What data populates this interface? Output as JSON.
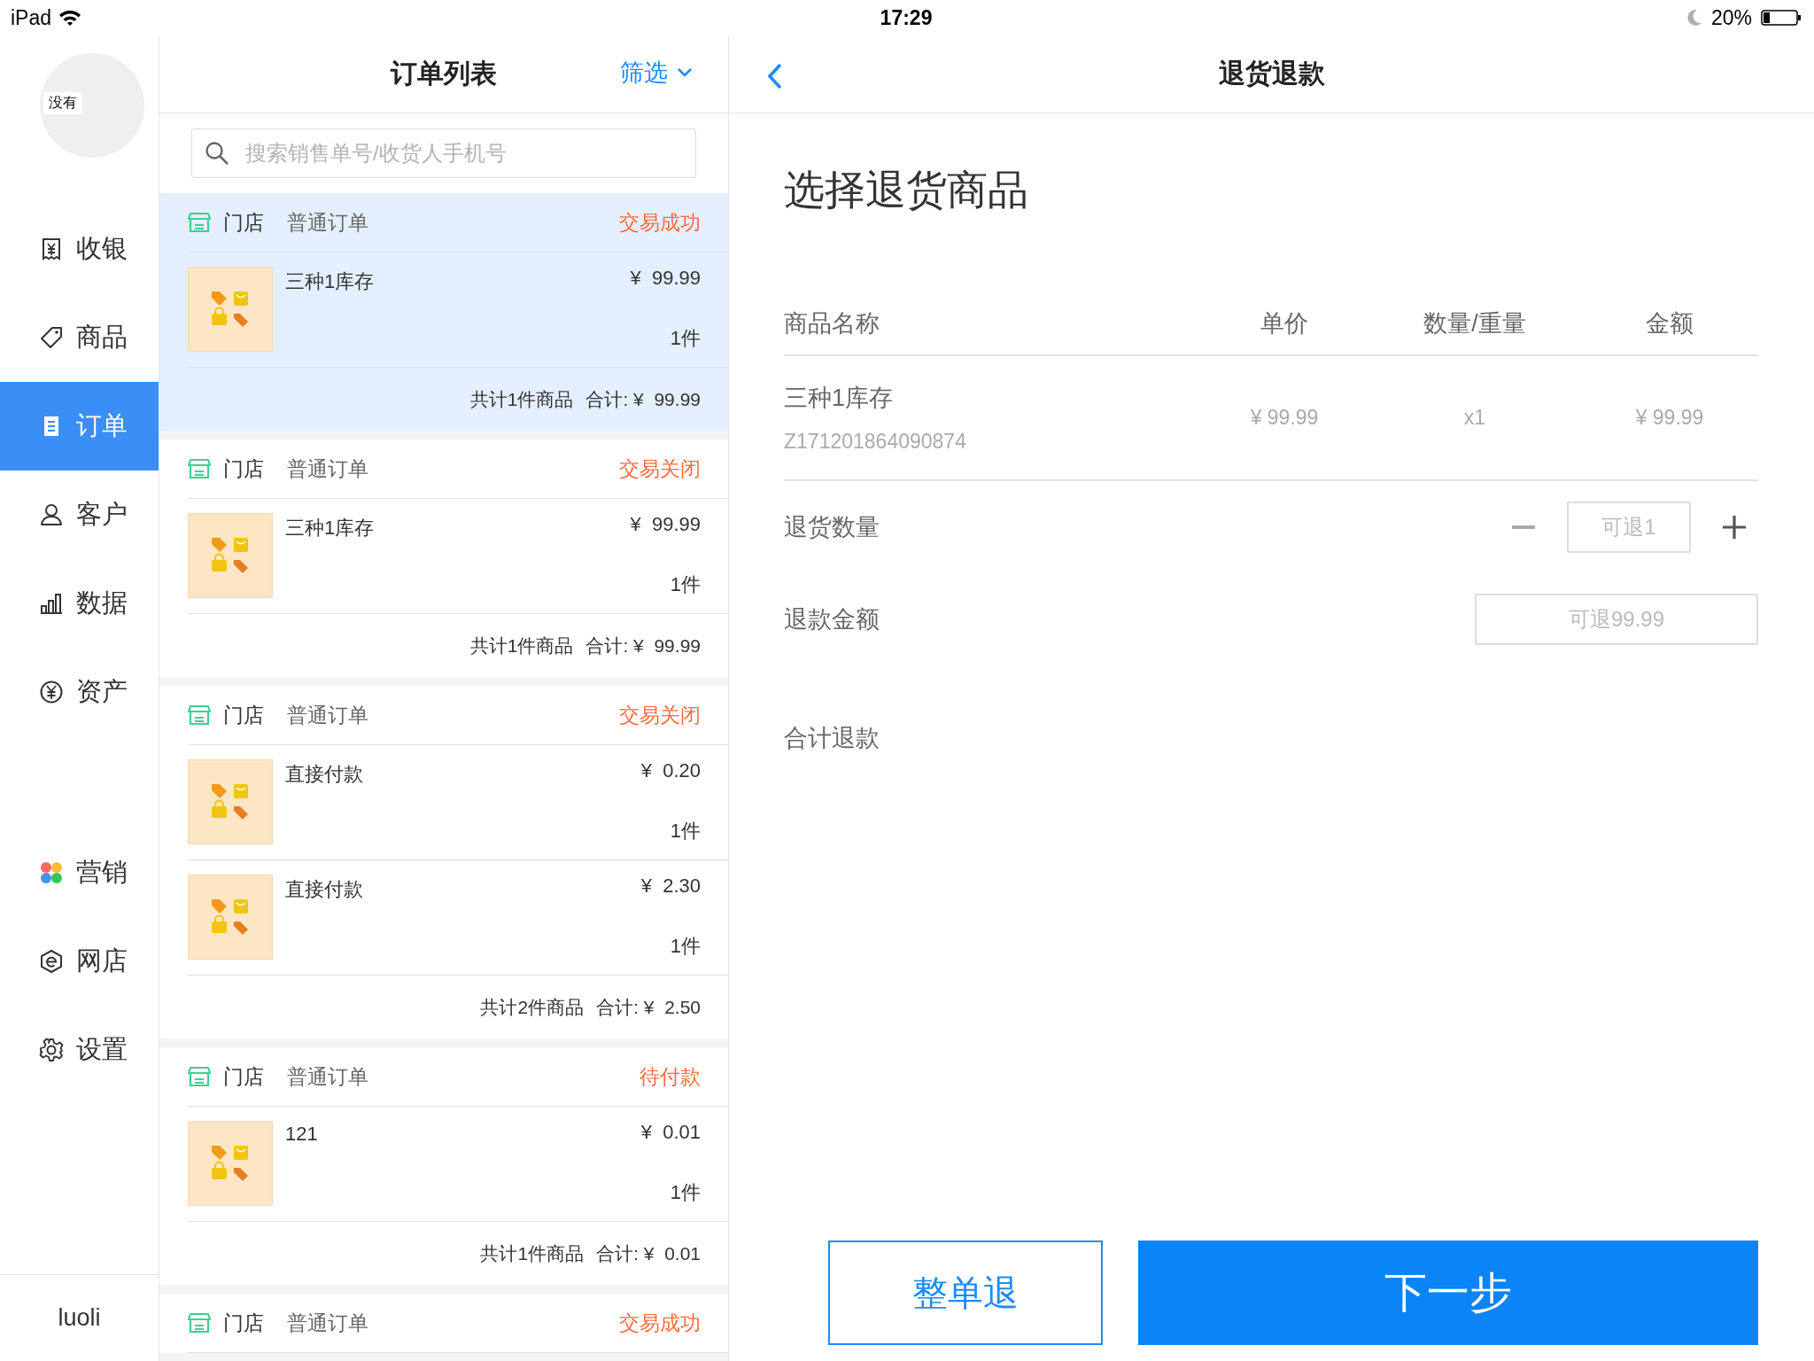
{
  "status_bar": {
    "device": "iPad",
    "time": "17:29",
    "battery": "20%"
  },
  "sidebar": {
    "avatar_text": "没有",
    "items": [
      {
        "label": "收银",
        "selected": false
      },
      {
        "label": "商品",
        "selected": false
      },
      {
        "label": "订单",
        "selected": true
      },
      {
        "label": "客户",
        "selected": false
      },
      {
        "label": "数据",
        "selected": false
      },
      {
        "label": "资产",
        "selected": false
      },
      {
        "label": "营销",
        "selected": false
      },
      {
        "label": "网店",
        "selected": false
      },
      {
        "label": "设置",
        "selected": false
      }
    ],
    "user": "luoli"
  },
  "order_list": {
    "title": "订单列表",
    "filter": "筛选",
    "search": {
      "placeholder": "搜索销售单号/收货人手机号"
    },
    "orders": [
      {
        "store": "门店",
        "type": "普通订单",
        "status": "交易成功",
        "selected": true,
        "items": [
          {
            "name": "三种1库存",
            "price": "¥  99.99",
            "qty": "1件"
          }
        ],
        "count": "共计1件商品",
        "total": "合计: ¥  99.99"
      },
      {
        "store": "门店",
        "type": "普通订单",
        "status": "交易关闭",
        "selected": false,
        "items": [
          {
            "name": "三种1库存",
            "price": "¥  99.99",
            "qty": "1件"
          }
        ],
        "count": "共计1件商品",
        "total": "合计: ¥  99.99"
      },
      {
        "store": "门店",
        "type": "普通订单",
        "status": "交易关闭",
        "selected": false,
        "items": [
          {
            "name": "直接付款",
            "price": "¥  0.20",
            "qty": "1件"
          },
          {
            "name": "直接付款",
            "price": "¥  2.30",
            "qty": "1件"
          }
        ],
        "count": "共计2件商品",
        "total": "合计: ¥  2.50"
      },
      {
        "store": "门店",
        "type": "普通订单",
        "status": "待付款",
        "selected": false,
        "items": [
          {
            "name": "121",
            "price": "¥  0.01",
            "qty": "1件"
          }
        ],
        "count": "共计1件商品",
        "total": "合计: ¥  0.01"
      },
      {
        "store": "门店",
        "type": "普通订单",
        "status": "交易成功",
        "selected": false
      }
    ]
  },
  "detail": {
    "title": "退货退款",
    "heading": "选择退货商品",
    "columns": [
      "商品名称",
      "单价",
      "数量/重量",
      "金额"
    ],
    "rows": [
      {
        "name": "三种1库存",
        "code": "Z171201864090874",
        "price": "¥ 99.99",
        "quantity": "x1",
        "amount": "¥ 99.99"
      }
    ],
    "fields": [
      {
        "kind": "stepper",
        "label": "退货数量",
        "placeholder": "可退1"
      },
      {
        "kind": "input",
        "label": "退款金额",
        "placeholder": "可退99.99"
      },
      {
        "kind": "total",
        "label": "合计退款"
      }
    ],
    "buttons": [
      {
        "kind": "outline",
        "label": "整单退"
      },
      {
        "kind": "primary",
        "label": "下一步"
      }
    ]
  }
}
